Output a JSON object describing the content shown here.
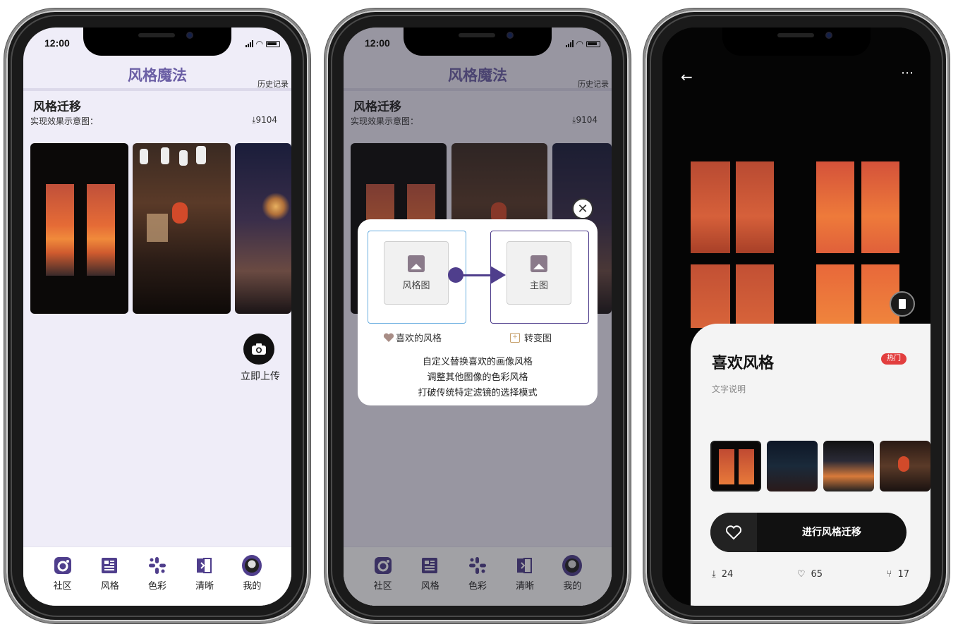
{
  "status": {
    "time": "12:00"
  },
  "app": {
    "title": "风格魔法",
    "history_label": "历史记录"
  },
  "section": {
    "title": "风格迁移",
    "subtitle": "实现效果示意图：",
    "downloads": "9104"
  },
  "upload": {
    "label": "立即上传",
    "icon": "camera-icon"
  },
  "tabs": [
    {
      "label": "社区",
      "icon": "community-icon"
    },
    {
      "label": "风格",
      "icon": "style-icon"
    },
    {
      "label": "色彩",
      "icon": "color-icon"
    },
    {
      "label": "清晰",
      "icon": "clarity-icon"
    },
    {
      "label": "我的",
      "icon": "avatar-icon"
    }
  ],
  "modal": {
    "style_image_label": "风格图",
    "main_image_label": "主图",
    "favorite_label": "喜欢的风格",
    "convert_label": "转变图",
    "lines": [
      "自定义替换喜欢的画像风格",
      "调整其他图像的色彩风格",
      "打破传统特定滤镜的选择模式"
    ],
    "close_icon": "close-icon"
  },
  "detail": {
    "title": "喜欢风格",
    "badge": "热门",
    "description": "文字说明",
    "cta_label": "进行风格迁移",
    "stats": {
      "downloads": "24",
      "likes": "65",
      "shares": "17"
    }
  },
  "colors": {
    "accent": "#6b5fa5",
    "dark_accent": "#4f3e8c",
    "hot": "#e23e3e",
    "background": "#efedf8"
  }
}
